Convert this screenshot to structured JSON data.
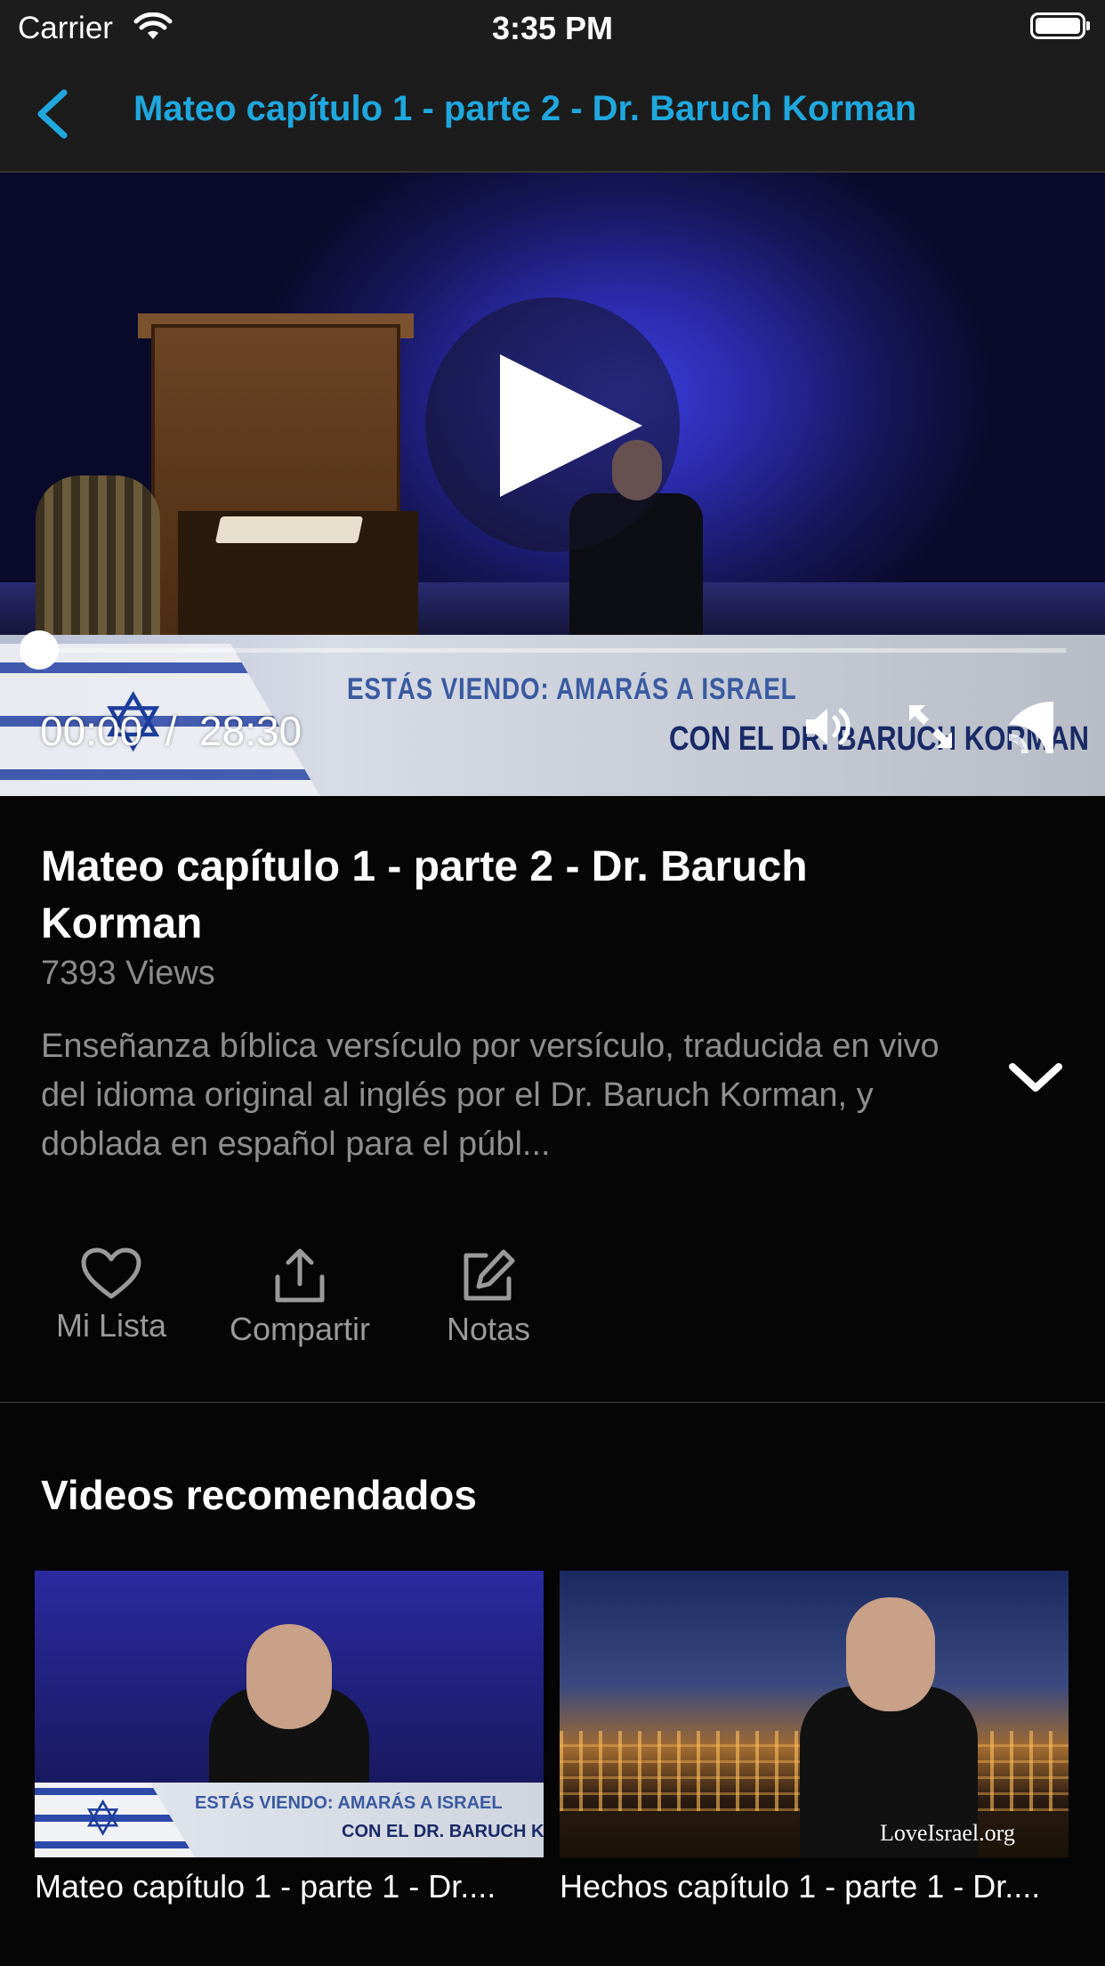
{
  "status_bar": {
    "carrier": "Carrier",
    "time": "3:35 PM"
  },
  "nav": {
    "title": "Mateo capítulo 1 - parte 2 - Dr. Baruch Korman"
  },
  "player": {
    "current_time": "00:00",
    "separator": "/",
    "duration": "28:30",
    "progress": 0,
    "banner_line1": "ESTÁS VIENDO: AMARÁS A ISRAEL",
    "banner_line2": "CON EL DR. BARUCH KORMAN",
    "icons": [
      "play-icon",
      "volume-icon",
      "fullscreen-icon",
      "cast-icon"
    ]
  },
  "video": {
    "title": "Mateo capítulo 1 - parte 2 - Dr. Baruch Korman",
    "views": "7393 Views",
    "description": "Enseñanza bíblica versículo por versículo, traducida en vivo del idioma original al inglés por el Dr. Baruch Korman, y doblada en español para el públ..."
  },
  "actions": [
    {
      "label": "Mi Lista",
      "icon": "heart-icon"
    },
    {
      "label": "Compartir",
      "icon": "share-icon"
    },
    {
      "label": "Notas",
      "icon": "edit-icon"
    }
  ],
  "recommended": {
    "heading": "Videos recomendados",
    "items": [
      {
        "caption": "Mateo capítulo 1 - parte 1 - Dr....",
        "banner_line1": "ESTÁS VIENDO: AMARÁS A ISRAEL",
        "banner_line2": "CON EL DR. BARUCH KORMAN"
      },
      {
        "caption": "Hechos capítulo 1 - parte 1 - Dr....",
        "watermark": "LoveIsrael.org"
      }
    ]
  },
  "colors": {
    "accent": "#1fa8de",
    "background": "#050505",
    "bar": "#1c1c1c"
  }
}
